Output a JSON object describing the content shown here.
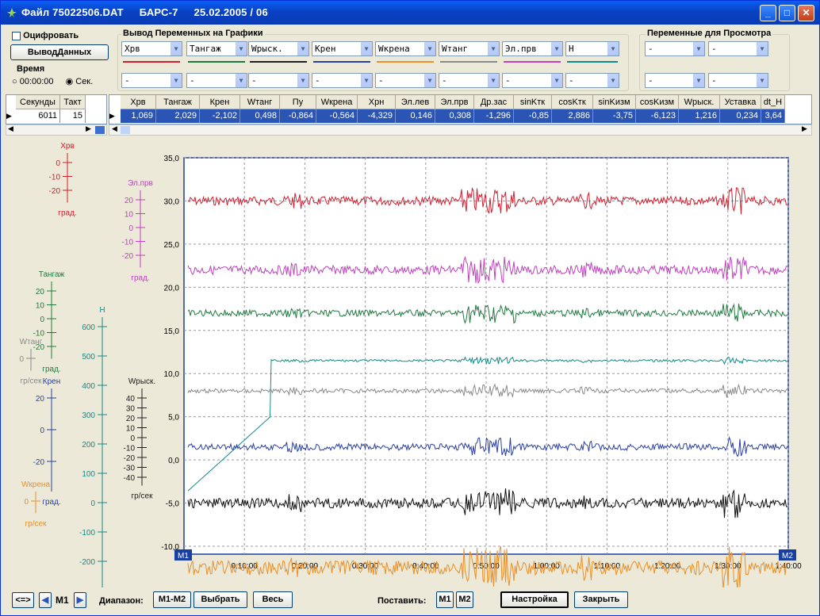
{
  "window": {
    "title_file": "Файл 75022506.DAT",
    "title_app": "БАРС-7",
    "title_date": "25.02.2005 / 06"
  },
  "left_panel": {
    "digitize_label": "Оцифровать",
    "output_button": "ВыводДанных",
    "time_group": "Время",
    "time_opt1": "00:00:00",
    "time_opt2": "Сек."
  },
  "graph_vars": {
    "group_title": "Вывод Переменных на Графики",
    "row1": [
      {
        "name": "Хрв",
        "color": "#d02030"
      },
      {
        "name": "Тангаж",
        "color": "#1f7a40"
      },
      {
        "name": "Wрыск.",
        "color": "#202020"
      },
      {
        "name": "Крен",
        "color": "#2a3fa0"
      },
      {
        "name": "Wкрена",
        "color": "#e8902a"
      },
      {
        "name": "Wтанг",
        "color": "#8a8a8a"
      },
      {
        "name": "Эл.прв",
        "color": "#c040c0"
      },
      {
        "name": "Н",
        "color": "#128a8a"
      }
    ],
    "row2": [
      "-",
      "-",
      "-",
      "-",
      "-",
      "-",
      "-",
      "-"
    ]
  },
  "view_vars": {
    "group_title": "Переменные для Просмотра",
    "row1": [
      "-",
      "-"
    ],
    "row2": [
      "-",
      "-"
    ]
  },
  "grid_left": {
    "headers": [
      "Секунды",
      "Такт"
    ],
    "values": [
      "6011",
      "15"
    ]
  },
  "grid_right": {
    "headers": [
      "Хрв",
      "Тангаж",
      "Крен",
      "Wтанг",
      "Пу",
      "Wкрена",
      "Хрн",
      "Эл.лев",
      "Эл.прв",
      "Др.зас",
      "sinKтк",
      "cosKтк",
      "sinKизм",
      "cosKизм",
      "Wрыск.",
      "Уставка",
      "dt_H"
    ],
    "values": [
      "1,069",
      "2,029",
      "-2,102",
      "0,498",
      "-0,864",
      "-0,564",
      "-4,329",
      "0,146",
      "0,308",
      "-1,296",
      "-0,85",
      "2,886",
      "-3,75",
      "-6,123",
      "1,216",
      "0,234",
      "3,64"
    ]
  },
  "chart_data": {
    "type": "line",
    "y_main_ticks": [
      "35,0",
      "30,0",
      "25,0",
      "20,0",
      "15,0",
      "10,0",
      "5,0",
      "0,0",
      "-5,0",
      "-10,0"
    ],
    "x_ticks": [
      "0:10:00",
      "0:20:00",
      "0:30:00",
      "0:40:00",
      "0:50:00",
      "1:00:00",
      "1:10:00",
      "1:20:00",
      "1:30:00",
      "1:40:00"
    ],
    "markers": [
      "M1",
      "M2"
    ],
    "scales": [
      {
        "name": "Хрв",
        "ticks": [
          "0",
          "-10",
          "-20"
        ],
        "unit": "град.",
        "color": "#d02030"
      },
      {
        "name": "Эл.прв",
        "ticks": [
          "20",
          "10",
          "0",
          "-10",
          "-20"
        ],
        "unit": "град.",
        "color": "#c040c0"
      },
      {
        "name": "Тангаж",
        "ticks": [
          "20",
          "10",
          "0",
          "-10",
          "-20"
        ],
        "unit": "град.",
        "color": "#1f7a40"
      },
      {
        "name": "Wтанг",
        "ticks": [
          "0"
        ],
        "unit": "гр/сек",
        "color": "#8a8a8a"
      },
      {
        "name": "Н",
        "ticks": [
          "600",
          "500",
          "400",
          "300",
          "200",
          "100",
          "0",
          "-100",
          "-200"
        ],
        "unit": "м",
        "color": "#128a8a"
      },
      {
        "name": "Крен",
        "ticks": [
          "20",
          "0",
          "-20"
        ],
        "unit": "град.",
        "color": "#2a3fa0"
      },
      {
        "name": "Wрыск.",
        "ticks": [
          "40",
          "30",
          "20",
          "10",
          "0",
          "-10",
          "-20",
          "-30",
          "-40"
        ],
        "unit": "гр/сек",
        "color": "#202020"
      },
      {
        "name": "Wкрена",
        "ticks": [
          "0"
        ],
        "unit": "гр/сек",
        "color": "#e8902a"
      }
    ],
    "series": [
      {
        "name": "Хрв",
        "color": "#d02030",
        "level": 30.0,
        "amp": 0.8
      },
      {
        "name": "Эл.прв",
        "color": "#c040c0",
        "level": 22.0,
        "amp": 0.8
      },
      {
        "name": "Тангаж",
        "color": "#1f7a40",
        "level": 17.0,
        "amp": 0.6
      },
      {
        "name": "Н",
        "color": "#128a8a",
        "level": 11.5,
        "amp": 0.2
      },
      {
        "name": "Wтанг",
        "color": "#8a8a8a",
        "level": 8.0,
        "amp": 0.4
      },
      {
        "name": "Крен",
        "color": "#2a3fa0",
        "level": 1.5,
        "amp": 0.6
      },
      {
        "name": "Wрыск.",
        "color": "#101010",
        "level": -5.0,
        "amp": 0.9
      },
      {
        "name": "Wкрена",
        "color": "#e8902a",
        "level": -12.5,
        "amp": 1.3
      }
    ]
  },
  "bottom": {
    "nav_label": "<=>",
    "m1_label": "M1",
    "range_label": "Диапазон:",
    "m1m2_button": "M1-M2",
    "select_button": "Выбрать",
    "all_button": "Весь",
    "set_label": "Поставить:",
    "set_m1": "M1",
    "set_m2": "M2",
    "settings_button": "Настройка",
    "close_button": "Закрыть"
  }
}
